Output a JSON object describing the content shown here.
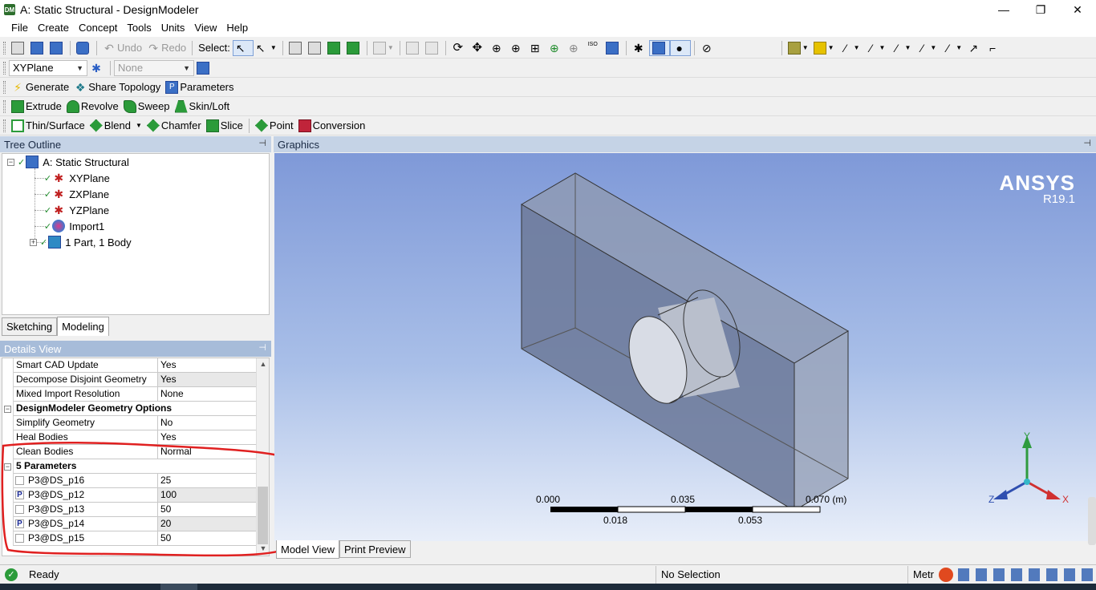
{
  "window": {
    "title": "A: Static Structural - DesignModeler",
    "app_icon": "DM",
    "controls": [
      "—",
      "❐",
      "✕"
    ]
  },
  "menu": [
    "File",
    "Create",
    "Concept",
    "Tools",
    "Units",
    "View",
    "Help"
  ],
  "toolbar1": {
    "undo_label": "Undo",
    "redo_label": "Redo",
    "select_label": "Select:"
  },
  "toolbar2": {
    "plane_value": "XYPlane",
    "sketch_value": "None"
  },
  "toolbar3": {
    "generate": "Generate",
    "share_topology": "Share Topology",
    "parameters": "Parameters"
  },
  "toolbar4": {
    "extrude": "Extrude",
    "revolve": "Revolve",
    "sweep": "Sweep",
    "skin_loft": "Skin/Loft"
  },
  "toolbar5": {
    "thin_surface": "Thin/Surface",
    "blend": "Blend",
    "chamfer": "Chamfer",
    "slice": "Slice",
    "point": "Point",
    "conversion": "Conversion"
  },
  "tree": {
    "header": "Tree Outline",
    "pin": "⊣",
    "items": [
      {
        "label": "A: Static Structural"
      },
      {
        "label": "XYPlane"
      },
      {
        "label": "ZXPlane"
      },
      {
        "label": "YZPlane"
      },
      {
        "label": "Import1"
      },
      {
        "label": "1 Part, 1 Body"
      }
    ],
    "tabs": [
      "Sketching",
      "Modeling"
    ]
  },
  "details": {
    "header": "Details View",
    "rows": [
      {
        "key": "Smart CAD Update",
        "value": "Yes"
      },
      {
        "key": "Decompose Disjoint Geometry",
        "value": "Yes"
      },
      {
        "key": "Mixed Import Resolution",
        "value": "None"
      },
      {
        "section": "DesignModeler Geometry Options"
      },
      {
        "key": "Simplify Geometry",
        "value": "No"
      },
      {
        "key": "Heal Bodies",
        "value": "Yes"
      },
      {
        "key": "Clean Bodies",
        "value": "Normal"
      },
      {
        "section": "5 Parameters"
      },
      {
        "key": "P3@DS_p16",
        "value": "25",
        "flag": ""
      },
      {
        "key": "P3@DS_p12",
        "value": "100",
        "flag": "P"
      },
      {
        "key": "P3@DS_p13",
        "value": "50",
        "flag": ""
      },
      {
        "key": "P3@DS_p14",
        "value": "20",
        "flag": "P"
      },
      {
        "key": "P3@DS_p15",
        "value": "50",
        "flag": ""
      }
    ]
  },
  "graphics": {
    "header": "Graphics",
    "brand": "ANSYS",
    "version": "R19.1",
    "scale": {
      "top_labels": [
        "0.000",
        "0.035",
        "0.070 (m)"
      ],
      "bottom_labels": [
        "0.018",
        "0.053"
      ]
    },
    "triad": {
      "x": "X",
      "y": "Y",
      "z": "Z"
    },
    "tabs": [
      "Model View",
      "Print Preview"
    ]
  },
  "status": {
    "ready": "Ready",
    "selection": "No Selection",
    "units_partial": "Metr"
  },
  "colors": {
    "panel_header": "#c5d3e6",
    "annotation_red": "#e02020",
    "viewport_top": "#7f99d8"
  }
}
